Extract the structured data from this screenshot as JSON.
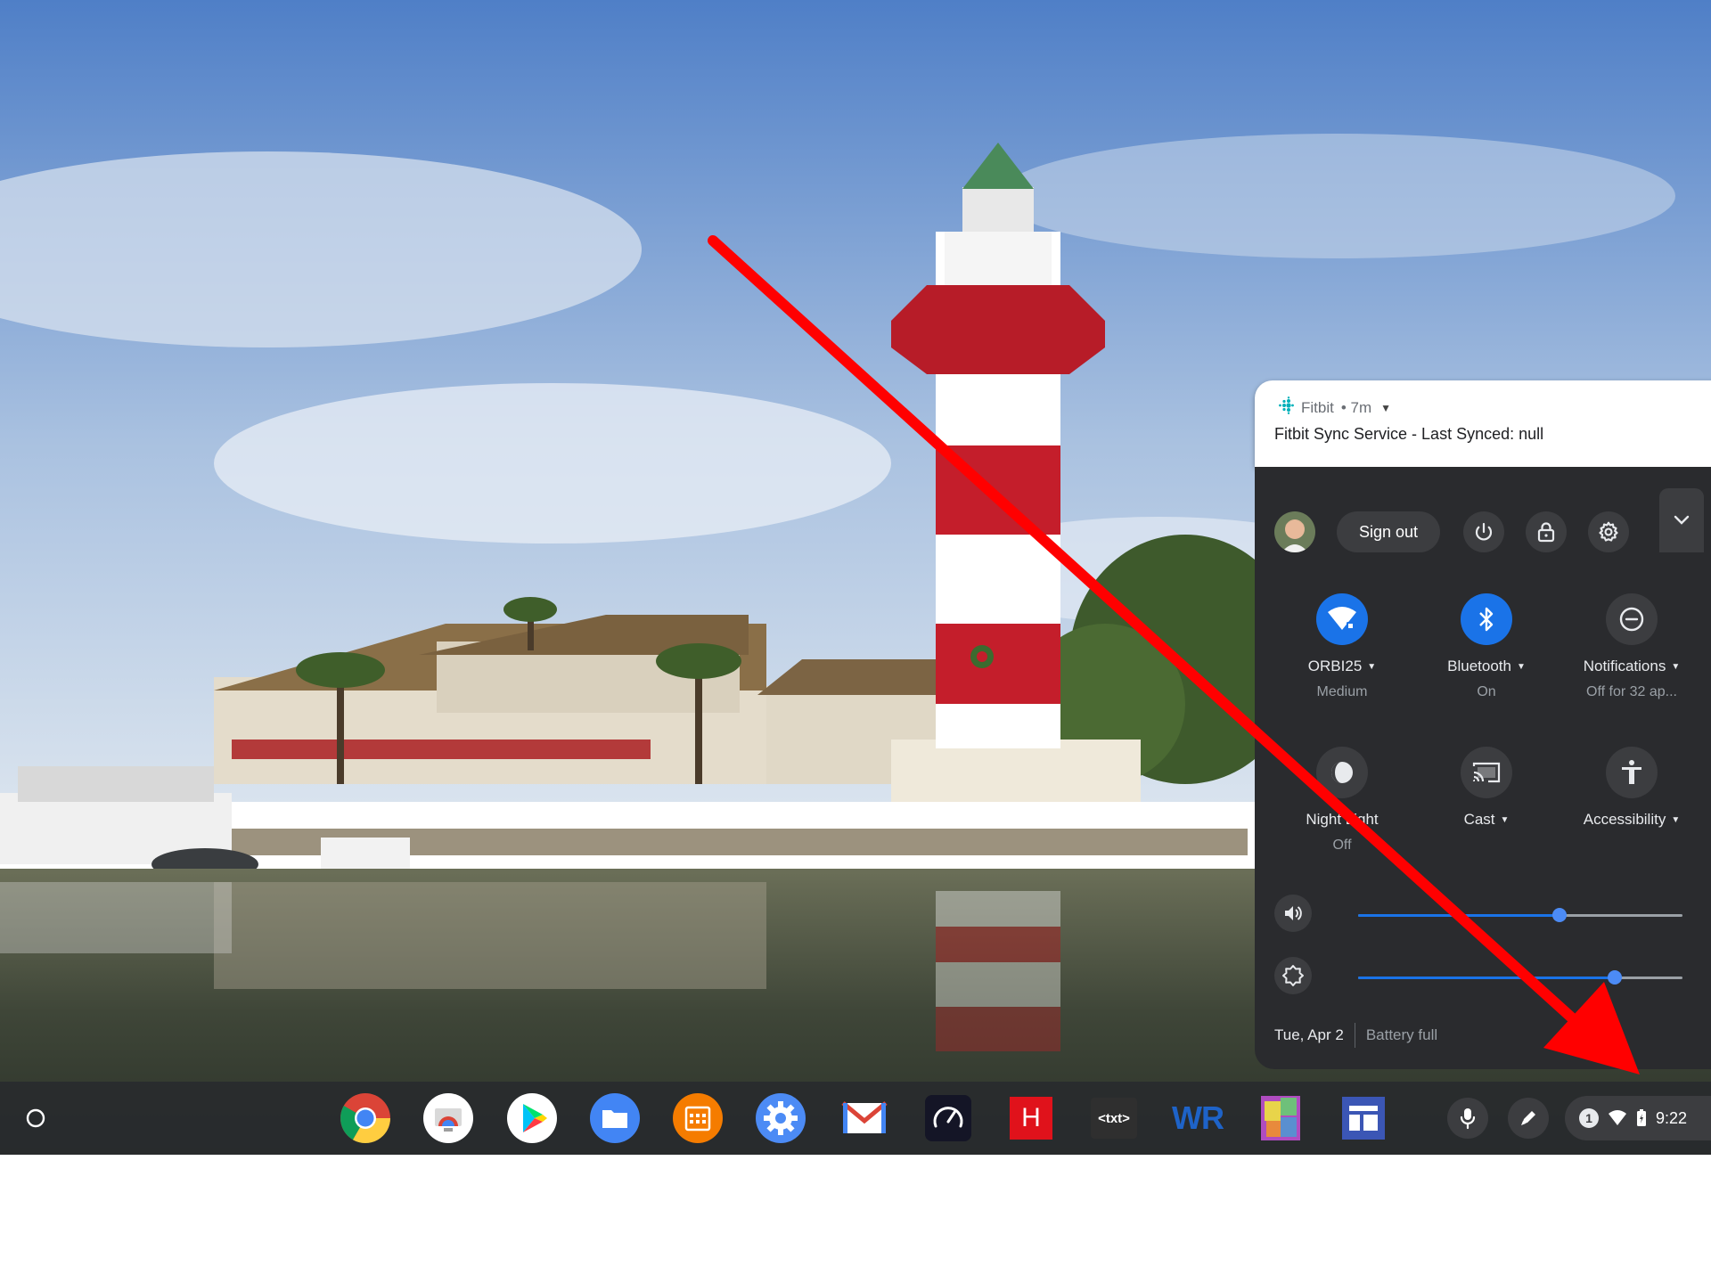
{
  "notification": {
    "app_name": "Fitbit",
    "age": "• 7m",
    "message": "Fitbit Sync Service - Last Synced: null"
  },
  "quick_settings": {
    "sign_out_label": "Sign out",
    "features": [
      {
        "label": "ORBI25",
        "sublabel": "Medium",
        "icon": "wifi-icon",
        "active": true
      },
      {
        "label": "Bluetooth",
        "sublabel": "On",
        "icon": "bluetooth-icon",
        "active": true
      },
      {
        "label": "Notifications",
        "sublabel": "Off for 32 ap...",
        "icon": "do-not-disturb-icon",
        "active": false
      },
      {
        "label": "Night Light",
        "sublabel": "Off",
        "icon": "night-light-icon",
        "active": false
      },
      {
        "label": "Cast",
        "sublabel": "",
        "icon": "cast-icon",
        "active": false
      },
      {
        "label": "Accessibility",
        "sublabel": "",
        "icon": "accessibility-icon",
        "active": false
      }
    ],
    "volume_level": 0.62,
    "brightness_level": 0.79,
    "date": "Tue, Apr 2",
    "battery_status": "Battery full"
  },
  "shelf": {
    "apps": [
      "Chrome",
      "Chrome Remote Desktop",
      "Play Store",
      "Files",
      "Calendar",
      "Settings",
      "Gmail",
      "Speedtest",
      "H",
      "txt",
      "WR",
      "Photo app",
      "Layout app"
    ],
    "h_app_letter": "H",
    "txt_app_text": "<txt>",
    "wr_app_text": "WR",
    "tray": {
      "notification_count": "1",
      "time": "9:22"
    }
  },
  "colors": {
    "accent": "#1a73e8",
    "panel_bg": "#2a2b2e",
    "arrow": "#ff0000"
  }
}
